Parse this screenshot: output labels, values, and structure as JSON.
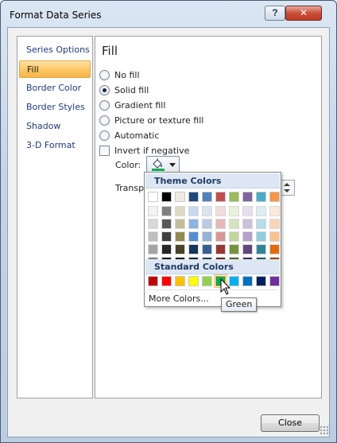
{
  "window": {
    "title": "Format Data Series",
    "help_label": "?",
    "close_label": "✕"
  },
  "nav": {
    "items": [
      {
        "label": "Series Options",
        "selected": false
      },
      {
        "label": "Fill",
        "selected": true
      },
      {
        "label": "Border Color",
        "selected": false
      },
      {
        "label": "Border Styles",
        "selected": false
      },
      {
        "label": "Shadow",
        "selected": false
      },
      {
        "label": "3-D Format",
        "selected": false
      }
    ]
  },
  "fill": {
    "title": "Fill",
    "options": [
      {
        "label": "No fill",
        "selected": false
      },
      {
        "label": "Solid fill",
        "selected": true
      },
      {
        "label": "Gradient fill",
        "selected": false
      },
      {
        "label": "Picture or texture fill",
        "selected": false
      },
      {
        "label": "Automatic",
        "selected": false
      }
    ],
    "invert_label": "Invert if negative",
    "invert_checked": false,
    "color_label": "Color:",
    "transparency_label": "Transpa",
    "current_color": "#00b050"
  },
  "palette": {
    "theme_header": "Theme Colors",
    "standard_header": "Standard Colors",
    "more_colors_label": "More Colors...",
    "theme_top": [
      "#ffffff",
      "#000000",
      "#eeece1",
      "#1f497d",
      "#4f81bd",
      "#c0504d",
      "#9bbb59",
      "#8064a2",
      "#4bacc6",
      "#f79646"
    ],
    "theme_tints": [
      [
        "#f2f2f2",
        "#7f7f7f",
        "#ddd9c3",
        "#c6d9f0",
        "#dbe5f1",
        "#f2dcdb",
        "#ebf1dd",
        "#e5e0ec",
        "#dbeef3",
        "#fdeada"
      ],
      [
        "#d8d8d8",
        "#595959",
        "#c4bd97",
        "#8db3e2",
        "#b8cce4",
        "#e5b9b7",
        "#d7e3bc",
        "#ccc1d9",
        "#b7dde8",
        "#fbd5b5"
      ],
      [
        "#bfbfbf",
        "#3f3f3f",
        "#938953",
        "#548dd4",
        "#95b3d7",
        "#d99694",
        "#c3d69b",
        "#b2a2c7",
        "#92cddc",
        "#fac08f"
      ],
      [
        "#a5a5a5",
        "#262626",
        "#494429",
        "#17365d",
        "#366092",
        "#953734",
        "#76923c",
        "#5f497a",
        "#31859b",
        "#e36c09"
      ],
      [
        "#7f7f7f",
        "#0c0c0c",
        "#1d1b10",
        "#0f243e",
        "#244061",
        "#632423",
        "#4f6128",
        "#3f3151",
        "#205867",
        "#974806"
      ]
    ],
    "standard": [
      "#c00000",
      "#ff0000",
      "#ffc000",
      "#ffff00",
      "#92d050",
      "#00b050",
      "#00b0f0",
      "#0070c0",
      "#002060",
      "#7030a0"
    ],
    "hover_index": 5,
    "tooltip": "Green"
  },
  "footer": {
    "close_label": "Close"
  }
}
